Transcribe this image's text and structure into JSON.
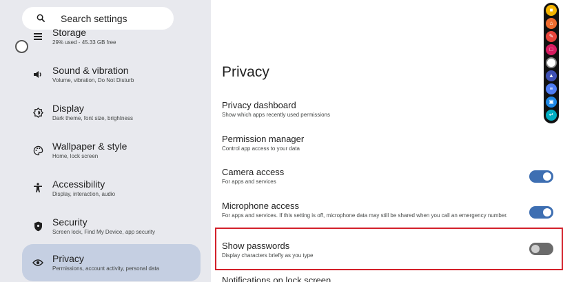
{
  "search": {
    "placeholder": "Search settings"
  },
  "sidebar": {
    "items": [
      {
        "label": "Storage",
        "sub": "29% used - 45.33 GB free",
        "icon": "storage-icon"
      },
      {
        "label": "Sound & vibration",
        "sub": "Volume, vibration, Do Not Disturb",
        "icon": "speaker-icon"
      },
      {
        "label": "Display",
        "sub": "Dark theme, font size, brightness",
        "icon": "brightness-icon"
      },
      {
        "label": "Wallpaper & style",
        "sub": "Home, lock screen",
        "icon": "palette-icon"
      },
      {
        "label": "Accessibility",
        "sub": "Display, interaction, audio",
        "icon": "accessibility-icon"
      },
      {
        "label": "Security",
        "sub": "Screen lock, Find My Device, app security",
        "icon": "shield-icon"
      },
      {
        "label": "Privacy",
        "sub": "Permissions, account activity, personal data",
        "icon": "privacy-eye-icon",
        "selected": true
      }
    ]
  },
  "main": {
    "title": "Privacy",
    "rows": [
      {
        "title": "Privacy dashboard",
        "sub": "Show which apps recently used permissions"
      },
      {
        "title": "Permission manager",
        "sub": "Control app access to your data"
      },
      {
        "title": "Camera access",
        "sub": "For apps and services",
        "toggle": "on"
      },
      {
        "title": "Microphone access",
        "sub": "For apps and services. If this setting is off, microphone data may still be shared when you call an emergency number.",
        "toggle": "on"
      },
      {
        "title": "Show passwords",
        "sub": "Display characters briefly as you type",
        "toggle": "off"
      },
      {
        "title": "Notifications on lock screen",
        "sub": ""
      }
    ]
  },
  "colors": {
    "accent": "#3e6fb2",
    "highlight": "#d3202a",
    "sidebar_bg": "#e8e9ee",
    "selected_bg": "#c5cfe2"
  },
  "dock": {
    "items": [
      {
        "icon": "note-icon",
        "color": "#f4b400"
      },
      {
        "icon": "home-icon",
        "color": "#ef6c2f"
      },
      {
        "icon": "edit-icon",
        "color": "#e8453c"
      },
      {
        "icon": "chat-icon",
        "color": "#d81b60"
      },
      {
        "icon": "circle-icon",
        "color": "#ffffff"
      },
      {
        "icon": "android-icon",
        "color": "#3f51b5"
      },
      {
        "icon": "sliders-icon",
        "color": "#4f7df3"
      },
      {
        "icon": "window-icon",
        "color": "#1e88e5"
      },
      {
        "icon": "enter-icon",
        "color": "#00acc1"
      }
    ]
  }
}
